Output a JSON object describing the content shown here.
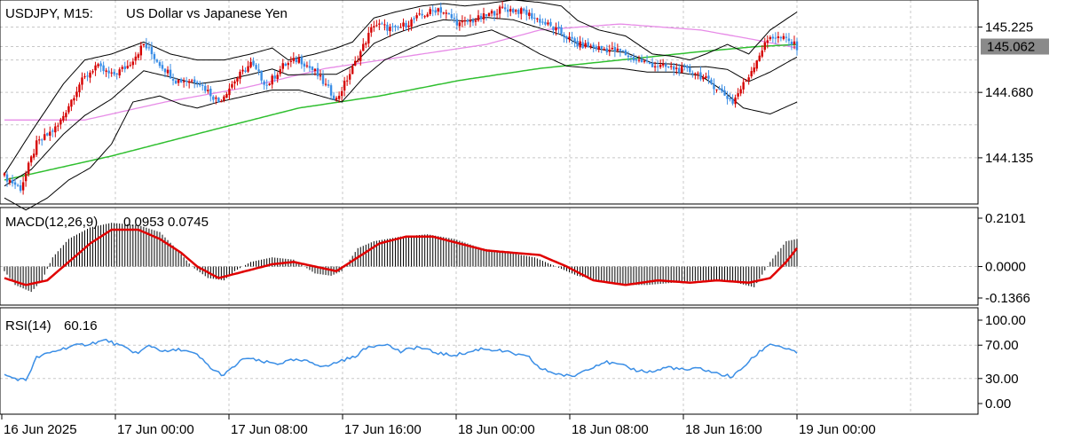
{
  "header": {
    "symbol_timeframe": "USDJPY, M15:",
    "description": "US Dollar vs Japanese Yen"
  },
  "colors": {
    "bull_candle": "#d60000",
    "bear_candle": "#3a8ee6",
    "bollinger": "#000000",
    "ma_fast": "#e78be7",
    "ma_slow": "#2fbf2f",
    "macd_hist": "#000000",
    "macd_signal": "#e00000",
    "rsi": "#3a8ee6",
    "price_badge_bg": "#8a8a8a",
    "price_badge_text": "#ffffff"
  },
  "chart_data": [
    {
      "type": "candlestick",
      "name": "price",
      "ylim": [
        143.75,
        145.45
      ],
      "y_ticks": [
        "145.225",
        "144.680",
        "144.135"
      ],
      "current_price": "145.062",
      "x_labels": [
        "16 Jun 2025",
        "17 Jun 00:00",
        "17 Jun 08:00",
        "17 Jun 16:00",
        "18 Jun 00:00",
        "18 Jun 08:00",
        "18 Jun 16:00",
        "19 Jun 00:00"
      ],
      "close_path": [
        [
          0,
          143.98
        ],
        [
          6,
          143.88
        ],
        [
          12,
          144.25
        ],
        [
          20,
          144.4
        ],
        [
          28,
          144.75
        ],
        [
          34,
          144.9
        ],
        [
          40,
          144.82
        ],
        [
          46,
          144.9
        ],
        [
          52,
          145.08
        ],
        [
          58,
          144.92
        ],
        [
          64,
          144.78
        ],
        [
          72,
          144.78
        ],
        [
          80,
          144.6
        ],
        [
          86,
          144.78
        ],
        [
          92,
          144.92
        ],
        [
          98,
          144.74
        ],
        [
          104,
          144.9
        ],
        [
          110,
          144.96
        ],
        [
          116,
          144.85
        ],
        [
          124,
          144.62
        ],
        [
          130,
          144.88
        ],
        [
          138,
          145.25
        ],
        [
          146,
          145.2
        ],
        [
          154,
          145.3
        ],
        [
          162,
          145.38
        ],
        [
          170,
          145.25
        ],
        [
          178,
          145.3
        ],
        [
          186,
          145.38
        ],
        [
          194,
          145.35
        ],
        [
          200,
          145.28
        ],
        [
          206,
          145.2
        ],
        [
          214,
          145.08
        ],
        [
          222,
          145.05
        ],
        [
          230,
          145.02
        ],
        [
          236,
          144.95
        ],
        [
          244,
          144.9
        ],
        [
          250,
          144.88
        ],
        [
          258,
          144.85
        ],
        [
          266,
          144.72
        ],
        [
          272,
          144.6
        ],
        [
          278,
          144.82
        ],
        [
          282,
          145.0
        ],
        [
          286,
          145.15
        ],
        [
          292,
          145.12
        ],
        [
          296,
          145.06
        ]
      ],
      "bollinger_upper": [
        [
          0,
          144.0
        ],
        [
          10,
          144.35
        ],
        [
          22,
          144.75
        ],
        [
          30,
          144.95
        ],
        [
          40,
          145.0
        ],
        [
          52,
          145.1
        ],
        [
          62,
          145.0
        ],
        [
          72,
          144.95
        ],
        [
          82,
          144.95
        ],
        [
          92,
          145.0
        ],
        [
          100,
          145.05
        ],
        [
          106,
          144.95
        ],
        [
          116,
          145.0
        ],
        [
          124,
          145.05
        ],
        [
          130,
          145.1
        ],
        [
          138,
          145.3
        ],
        [
          146,
          145.35
        ],
        [
          156,
          145.4
        ],
        [
          164,
          145.42
        ],
        [
          172,
          145.4
        ],
        [
          180,
          145.42
        ],
        [
          190,
          145.45
        ],
        [
          200,
          145.43
        ],
        [
          208,
          145.4
        ],
        [
          214,
          145.28
        ],
        [
          222,
          145.2
        ],
        [
          232,
          145.15
        ],
        [
          242,
          145.0
        ],
        [
          250,
          144.98
        ],
        [
          256,
          144.95
        ],
        [
          262,
          145.0
        ],
        [
          270,
          145.08
        ],
        [
          278,
          145.0
        ],
        [
          286,
          145.2
        ],
        [
          296,
          145.35
        ]
      ],
      "bollinger_lower": [
        [
          0,
          143.8
        ],
        [
          8,
          143.7
        ],
        [
          16,
          143.8
        ],
        [
          24,
          143.95
        ],
        [
          32,
          144.05
        ],
        [
          40,
          144.25
        ],
        [
          48,
          144.6
        ],
        [
          58,
          144.65
        ],
        [
          66,
          144.58
        ],
        [
          72,
          144.55
        ],
        [
          80,
          144.6
        ],
        [
          90,
          144.65
        ],
        [
          100,
          144.7
        ],
        [
          110,
          144.7
        ],
        [
          118,
          144.65
        ],
        [
          126,
          144.6
        ],
        [
          134,
          144.8
        ],
        [
          142,
          144.95
        ],
        [
          152,
          145.05
        ],
        [
          162,
          145.15
        ],
        [
          172,
          145.15
        ],
        [
          182,
          145.2
        ],
        [
          192,
          145.1
        ],
        [
          200,
          145.0
        ],
        [
          210,
          144.9
        ],
        [
          220,
          144.88
        ],
        [
          230,
          144.88
        ],
        [
          240,
          144.85
        ],
        [
          250,
          144.85
        ],
        [
          260,
          144.82
        ],
        [
          268,
          144.7
        ],
        [
          276,
          144.55
        ],
        [
          286,
          144.5
        ],
        [
          296,
          144.6
        ]
      ],
      "ma_fast": [
        [
          0,
          144.45
        ],
        [
          30,
          144.45
        ],
        [
          60,
          144.6
        ],
        [
          90,
          144.72
        ],
        [
          120,
          144.88
        ],
        [
          150,
          144.98
        ],
        [
          180,
          145.08
        ],
        [
          200,
          145.2
        ],
        [
          230,
          145.25
        ],
        [
          260,
          145.2
        ],
        [
          280,
          145.12
        ],
        [
          296,
          145.05
        ]
      ],
      "ma_slow": [
        [
          0,
          143.95
        ],
        [
          40,
          144.15
        ],
        [
          80,
          144.38
        ],
        [
          110,
          144.55
        ],
        [
          140,
          144.65
        ],
        [
          170,
          144.78
        ],
        [
          200,
          144.88
        ],
        [
          230,
          144.95
        ],
        [
          260,
          145.02
        ],
        [
          280,
          145.06
        ],
        [
          296,
          145.08
        ]
      ],
      "n_bars": 297
    },
    {
      "type": "bar",
      "name": "MACD(12,26,9)",
      "legend_name": "MACD(12,26,9)",
      "legend_values": "0.0953 0.0745",
      "ylim": [
        -0.1366,
        0.2101
      ],
      "y_ticks": [
        "0.2101",
        "0.0000",
        "-0.1366"
      ],
      "hist_path": [
        [
          0,
          -0.02
        ],
        [
          4,
          -0.08
        ],
        [
          10,
          -0.11
        ],
        [
          14,
          -0.06
        ],
        [
          18,
          0.04
        ],
        [
          24,
          0.12
        ],
        [
          32,
          0.17
        ],
        [
          40,
          0.19
        ],
        [
          50,
          0.18
        ],
        [
          58,
          0.15
        ],
        [
          64,
          0.08
        ],
        [
          70,
          0.0
        ],
        [
          76,
          -0.05
        ],
        [
          82,
          -0.06
        ],
        [
          86,
          -0.02
        ],
        [
          92,
          0.02
        ],
        [
          100,
          0.04
        ],
        [
          108,
          0.03
        ],
        [
          116,
          -0.03
        ],
        [
          122,
          -0.04
        ],
        [
          126,
          -0.02
        ],
        [
          132,
          0.08
        ],
        [
          138,
          0.11
        ],
        [
          148,
          0.13
        ],
        [
          158,
          0.14
        ],
        [
          168,
          0.12
        ],
        [
          178,
          0.08
        ],
        [
          188,
          0.06
        ],
        [
          198,
          0.04
        ],
        [
          206,
          0.0
        ],
        [
          214,
          -0.04
        ],
        [
          222,
          -0.06
        ],
        [
          230,
          -0.08
        ],
        [
          240,
          -0.08
        ],
        [
          250,
          -0.07
        ],
        [
          260,
          -0.06
        ],
        [
          270,
          -0.06
        ],
        [
          280,
          -0.09
        ],
        [
          286,
          0.02
        ],
        [
          292,
          0.11
        ],
        [
          296,
          0.12
        ]
      ],
      "signal_path": [
        [
          0,
          -0.05
        ],
        [
          8,
          -0.08
        ],
        [
          16,
          -0.06
        ],
        [
          24,
          0.02
        ],
        [
          32,
          0.1
        ],
        [
          40,
          0.16
        ],
        [
          50,
          0.16
        ],
        [
          58,
          0.12
        ],
        [
          66,
          0.06
        ],
        [
          72,
          0.0
        ],
        [
          80,
          -0.05
        ],
        [
          90,
          -0.02
        ],
        [
          100,
          0.01
        ],
        [
          108,
          0.02
        ],
        [
          116,
          0.0
        ],
        [
          124,
          -0.02
        ],
        [
          132,
          0.04
        ],
        [
          140,
          0.1
        ],
        [
          150,
          0.13
        ],
        [
          160,
          0.13
        ],
        [
          170,
          0.1
        ],
        [
          180,
          0.07
        ],
        [
          190,
          0.06
        ],
        [
          200,
          0.05
        ],
        [
          210,
          0.0
        ],
        [
          220,
          -0.06
        ],
        [
          232,
          -0.08
        ],
        [
          244,
          -0.06
        ],
        [
          256,
          -0.07
        ],
        [
          266,
          -0.06
        ],
        [
          278,
          -0.07
        ],
        [
          286,
          -0.05
        ],
        [
          292,
          0.02
        ],
        [
          296,
          0.08
        ]
      ]
    },
    {
      "type": "line",
      "name": "RSI(14)",
      "legend_name": "RSI(14)",
      "legend_value": "60.16",
      "ylim": [
        0,
        100
      ],
      "y_ticks": [
        100,
        70,
        30,
        0
      ],
      "y_tick_labels": [
        "100.00",
        "70.00",
        "30.00",
        "0.00"
      ],
      "values_path": [
        [
          0,
          34
        ],
        [
          4,
          30
        ],
        [
          8,
          28
        ],
        [
          12,
          55
        ],
        [
          18,
          62
        ],
        [
          24,
          68
        ],
        [
          32,
          72
        ],
        [
          38,
          76
        ],
        [
          44,
          68
        ],
        [
          50,
          60
        ],
        [
          54,
          70
        ],
        [
          60,
          62
        ],
        [
          66,
          65
        ],
        [
          72,
          58
        ],
        [
          78,
          40
        ],
        [
          82,
          34
        ],
        [
          86,
          45
        ],
        [
          90,
          55
        ],
        [
          96,
          50
        ],
        [
          102,
          48
        ],
        [
          108,
          52
        ],
        [
          114,
          50
        ],
        [
          120,
          44
        ],
        [
          126,
          52
        ],
        [
          130,
          55
        ],
        [
          136,
          68
        ],
        [
          142,
          72
        ],
        [
          148,
          62
        ],
        [
          154,
          68
        ],
        [
          160,
          62
        ],
        [
          166,
          58
        ],
        [
          172,
          60
        ],
        [
          178,
          66
        ],
        [
          184,
          64
        ],
        [
          190,
          60
        ],
        [
          196,
          55
        ],
        [
          200,
          42
        ],
        [
          206,
          36
        ],
        [
          212,
          32
        ],
        [
          218,
          42
        ],
        [
          224,
          50
        ],
        [
          230,
          46
        ],
        [
          236,
          40
        ],
        [
          242,
          38
        ],
        [
          248,
          44
        ],
        [
          254,
          40
        ],
        [
          260,
          42
        ],
        [
          266,
          36
        ],
        [
          272,
          32
        ],
        [
          278,
          50
        ],
        [
          282,
          62
        ],
        [
          286,
          72
        ],
        [
          292,
          66
        ],
        [
          296,
          60
        ]
      ]
    }
  ]
}
